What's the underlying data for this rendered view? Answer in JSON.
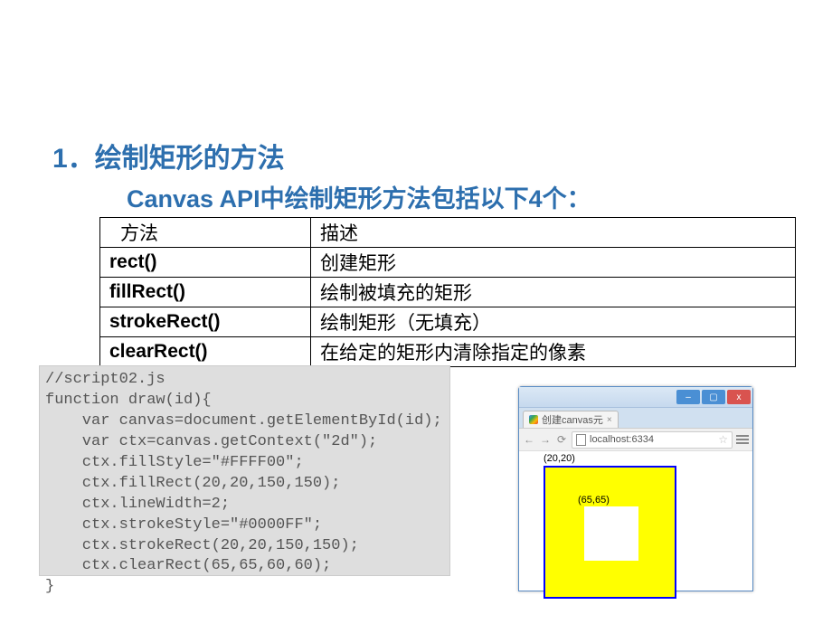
{
  "heading": {
    "number": "1",
    "separator": "．",
    "title": "绘制矩形的方法"
  },
  "subheading": {
    "prefix": "Canvas API",
    "middle": "中绘制矩形方法包括以下",
    "count": "4",
    "suffix": "个："
  },
  "table": {
    "headers": {
      "method": "方法",
      "desc": "描述"
    },
    "rows": [
      {
        "method": "rect()",
        "desc": "创建矩形"
      },
      {
        "method": "fillRect()",
        "desc": "绘制被填充的矩形"
      },
      {
        "method": "strokeRect()",
        "desc": "绘制矩形（无填充）"
      },
      {
        "method": "clearRect()",
        "desc": "在给定的矩形内清除指定的像素"
      }
    ]
  },
  "code": "//script02.js\nfunction draw(id){\n    var canvas=document.getElementById(id);\n    var ctx=canvas.getContext(\"2d\");\n    ctx.fillStyle=\"#FFFF00\";\n    ctx.fillRect(20,20,150,150);\n    ctx.lineWidth=2;\n    ctx.strokeStyle=\"#0000FF\";\n    ctx.strokeRect(20,20,150,150);\n    ctx.clearRect(65,65,60,60);\n}",
  "browser": {
    "tab_title": "创建canvas元",
    "url": "localhost:6334",
    "window_buttons": {
      "min": "–",
      "max": "▢",
      "close": "x"
    },
    "nav": {
      "back": "←",
      "fwd": "→",
      "reload": "⟳"
    },
    "canvas": {
      "coord1": "(20,20)",
      "coord2": "(65,65)",
      "fillColor": "#FFFF00",
      "strokeColor": "#0000FF",
      "clearColor": "#FFFFFF"
    }
  }
}
